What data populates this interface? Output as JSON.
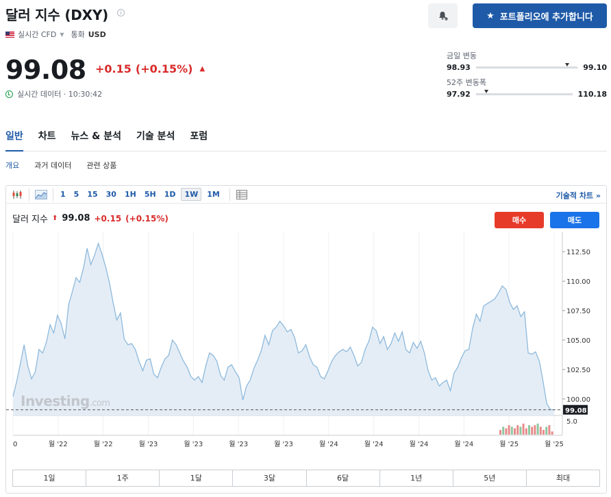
{
  "header": {
    "title": "달러 지수 (DXY)",
    "info_icon": "info-icon",
    "market_type": "실시간 CFD",
    "currency_label": "통화",
    "currency_value": "USD",
    "alert_icon": "bell-plus-icon",
    "portfolio_button": "포트폴리오에 추가합니다"
  },
  "quote": {
    "price": "99.08",
    "change": "+0.15",
    "change_pct": "(+0.15%)",
    "direction_glyph": "▲",
    "realtime_text": "실시간 데이터 · 10:30:42"
  },
  "ranges": {
    "day_label": "금일 변동",
    "day_low": "98.93",
    "day_high": "99.10",
    "day_position": 0.88,
    "week52_label": "52주 변동폭",
    "week52_low": "97.92",
    "week52_high": "110.18",
    "week52_position": 0.09
  },
  "tabs": [
    "일반",
    "차트",
    "뉴스 & 분석",
    "기술 분석",
    "포럼"
  ],
  "subtabs": [
    "개요",
    "과거 데이터",
    "관련 상품"
  ],
  "toolbar": {
    "timeframes": [
      "1",
      "5",
      "15",
      "30",
      "1H",
      "5H",
      "1D",
      "1W",
      "1M"
    ],
    "active_timeframe": "1W",
    "technical_link": "기술적 차트 »"
  },
  "chart_header": {
    "name": "달러 지수",
    "price": "99.08",
    "change": "+0.15",
    "change_pct": "(+0.15%)",
    "buy_label": "매수",
    "sell_label": "매도"
  },
  "watermark": {
    "brand": "Investing",
    "suffix": ".com"
  },
  "periods": [
    "1일",
    "1주",
    "1달",
    "3달",
    "6달",
    "1년",
    "5년",
    "최대"
  ],
  "colors": {
    "accent": "#1e5aa8",
    "up_red": "#d92b2b",
    "line_blue": "#8db9dc",
    "area_fill": "#e4edf6"
  },
  "chart_data": {
    "type": "area",
    "x_tick_labels": [
      "0",
      "월 '22",
      "월 '22",
      "월 '23",
      "월 '23",
      "월 '23",
      "월 '23",
      "월 '24",
      "월 '24",
      "월 '24",
      "월 '24",
      "월 '25",
      "월 '25"
    ],
    "y_ticks": [
      100.0,
      102.5,
      105.0,
      107.5,
      110.0,
      112.5
    ],
    "y_tick_labels": [
      "100.00",
      "102.50",
      "105.00",
      "107.50",
      "110.00",
      "112.50"
    ],
    "ylim": [
      98.6,
      114.2
    ],
    "last_price_label": "99.08",
    "last_price": 99.08,
    "volume_axis_label": "5.0",
    "values": [
      100.2,
      101.5,
      103.0,
      104.6,
      102.8,
      101.7,
      102.3,
      104.2,
      103.9,
      104.8,
      106.3,
      105.6,
      107.1,
      106.4,
      105.1,
      108.0,
      109.1,
      110.3,
      109.9,
      111.1,
      112.8,
      111.4,
      112.2,
      113.2,
      112.3,
      111.2,
      109.9,
      108.2,
      106.7,
      107.3,
      105.1,
      104.6,
      104.7,
      104.2,
      103.2,
      102.4,
      103.3,
      103.4,
      102.1,
      101.8,
      102.7,
      103.4,
      103.7,
      105.0,
      104.6,
      103.9,
      103.2,
      102.7,
      101.9,
      101.6,
      101.9,
      101.4,
      102.8,
      103.9,
      103.7,
      103.2,
      102.0,
      101.6,
      102.7,
      102.9,
      102.3,
      101.8,
      99.9,
      101.1,
      101.6,
      102.6,
      103.3,
      104.1,
      105.4,
      104.6,
      105.8,
      106.1,
      106.6,
      106.2,
      105.7,
      105.9,
      105.2,
      103.9,
      104.1,
      104.6,
      103.6,
      102.9,
      102.7,
      101.9,
      101.7,
      102.4,
      103.2,
      103.7,
      104.0,
      104.2,
      104.0,
      104.4,
      103.7,
      102.8,
      103.1,
      104.2,
      104.9,
      106.1,
      105.8,
      104.7,
      105.3,
      104.2,
      104.7,
      105.6,
      104.9,
      105.7,
      104.2,
      103.9,
      104.8,
      104.3,
      104.9,
      103.9,
      102.4,
      101.6,
      101.8,
      101.1,
      101.4,
      101.6,
      100.7,
      102.2,
      102.7,
      103.5,
      104.1,
      104.2,
      106.0,
      107.2,
      106.6,
      107.9,
      108.1,
      108.3,
      108.5,
      109.0,
      109.6,
      109.3,
      108.2,
      107.6,
      107.9,
      107.0,
      107.4,
      103.9,
      103.8,
      104.0,
      103.2,
      101.5,
      99.6,
      99.1,
      99.08
    ],
    "volume_bars": [
      3,
      5,
      4,
      6,
      5,
      4,
      6,
      5,
      7,
      4,
      6,
      5,
      6,
      7,
      5,
      3,
      5,
      6,
      2
    ]
  }
}
